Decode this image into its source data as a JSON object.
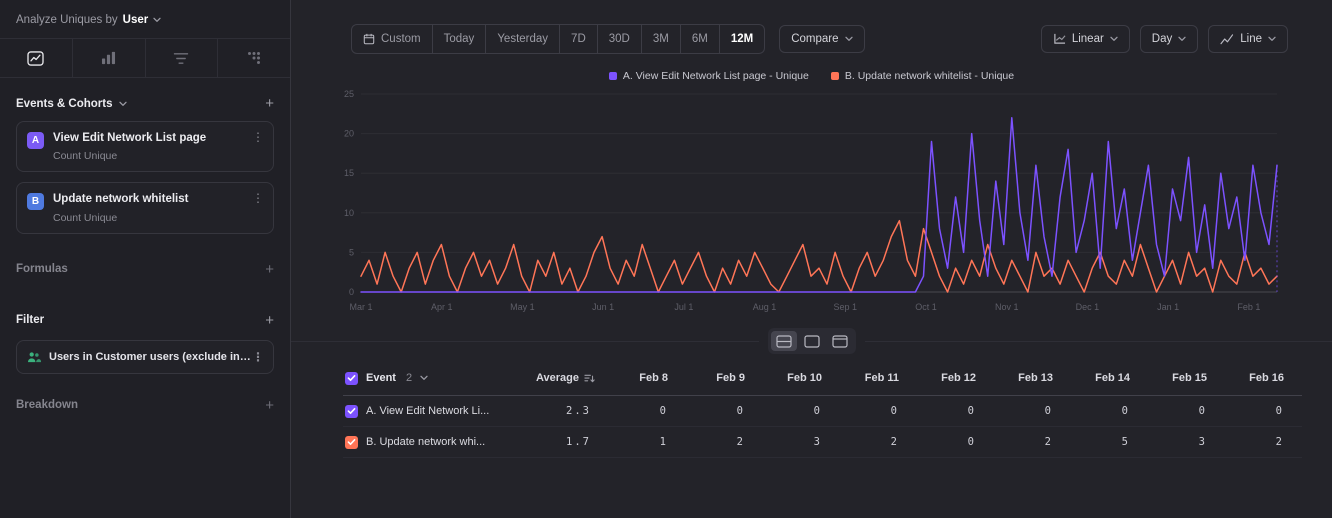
{
  "sidebar": {
    "analyze": {
      "label": "Analyze Uniques by",
      "value": "User"
    },
    "tabs": [
      "insights",
      "funnels",
      "flows",
      "retention"
    ],
    "active_tab": "insights",
    "events_section": {
      "title": "Events & Cohorts",
      "add_label": "+"
    },
    "events": [
      {
        "badge": "A",
        "badge_color": "#7b5bf5",
        "name": "View Edit Network List page",
        "subtitle": "Count Unique"
      },
      {
        "badge": "B",
        "badge_color": "#4f7ae0",
        "name": "Update network whitelist",
        "subtitle": "Count Unique"
      }
    ],
    "formulas_section": {
      "title": "Formulas",
      "add_label": "+"
    },
    "filter_section": {
      "title": "Filter",
      "add_label": "+"
    },
    "filters": [
      {
        "label": "Users in Customer users (exclude intern...",
        "icon": "users",
        "icon_color": "#3bb27e"
      }
    ],
    "breakdown_section": {
      "title": "Breakdown",
      "add_label": "+"
    }
  },
  "toolbar": {
    "date_ranges": [
      "Custom",
      "Today",
      "Yesterday",
      "7D",
      "30D",
      "3M",
      "6M",
      "12M"
    ],
    "selected_range": "12M",
    "compare_label": "Compare",
    "scale_label": "Linear",
    "granularity_label": "Day",
    "chart_type_label": "Line"
  },
  "legend": [
    {
      "label": "A. View Edit Network List page - Unique",
      "color": "#7c52ff"
    },
    {
      "label": "B. Update network whitelist - Unique",
      "color": "#ff7557"
    }
  ],
  "chart_data": {
    "type": "line",
    "title": "",
    "xlabel": "",
    "ylabel": "",
    "ylim": [
      0,
      25
    ],
    "yticks": [
      0,
      5,
      10,
      15,
      20,
      25
    ],
    "x_tick_labels": [
      "Mar 1",
      "Apr 1",
      "May 1",
      "Jun 1",
      "Jul 1",
      "Aug 1",
      "Sep 1",
      "Oct 1",
      "Nov 1",
      "Dec 1",
      "Jan 1",
      "Feb 1"
    ],
    "x_unit": "day",
    "grid": "horizontal",
    "legend_position": "top-center",
    "series": [
      {
        "name": "A. View Edit Network List page - Unique",
        "color": "#7c52ff",
        "values": [
          0,
          0,
          0,
          0,
          0,
          0,
          0,
          0,
          0,
          0,
          0,
          0,
          0,
          0,
          0,
          0,
          0,
          0,
          0,
          0,
          0,
          0,
          0,
          0,
          0,
          0,
          0,
          0,
          0,
          0,
          0,
          0,
          0,
          0,
          0,
          0,
          0,
          0,
          0,
          0,
          0,
          0,
          0,
          0,
          0,
          0,
          0,
          0,
          0,
          0,
          0,
          0,
          0,
          0,
          0,
          0,
          0,
          0,
          0,
          0,
          0,
          0,
          0,
          0,
          0,
          0,
          0,
          0,
          0,
          0,
          2,
          19,
          8,
          3,
          12,
          5,
          20,
          9,
          2,
          14,
          6,
          22,
          10,
          4,
          16,
          7,
          2,
          12,
          18,
          5,
          9,
          15,
          3,
          19,
          8,
          13,
          4,
          10,
          16,
          6,
          2,
          13,
          9,
          17,
          5,
          11,
          3,
          15,
          8,
          12,
          4,
          16,
          10,
          6,
          16
        ]
      },
      {
        "name": "B. Update network whitelist - Unique",
        "color": "#ff7557",
        "values": [
          2,
          4,
          1,
          5,
          2,
          0,
          3,
          5,
          1,
          4,
          6,
          2,
          0,
          3,
          5,
          2,
          4,
          1,
          3,
          6,
          2,
          0,
          4,
          2,
          5,
          1,
          3,
          0,
          2,
          5,
          7,
          3,
          1,
          4,
          2,
          6,
          3,
          0,
          2,
          4,
          1,
          3,
          5,
          2,
          0,
          3,
          1,
          4,
          2,
          5,
          3,
          1,
          0,
          2,
          4,
          6,
          2,
          3,
          1,
          5,
          2,
          0,
          3,
          5,
          2,
          4,
          7,
          9,
          4,
          2,
          8,
          5,
          2,
          0,
          3,
          1,
          4,
          2,
          6,
          3,
          1,
          4,
          2,
          0,
          5,
          2,
          3,
          1,
          4,
          2,
          0,
          3,
          5,
          2,
          1,
          4,
          2,
          6,
          3,
          0,
          2,
          4,
          1,
          5,
          2,
          3,
          0,
          4,
          2,
          1,
          5,
          2,
          3,
          1,
          2
        ]
      }
    ]
  },
  "table": {
    "event_header": "Event",
    "event_count": "2",
    "average_header": "Average",
    "date_columns": [
      "Feb 8",
      "Feb 9",
      "Feb 10",
      "Feb 11",
      "Feb 12",
      "Feb 13",
      "Feb 14",
      "Feb 15",
      "Feb 16"
    ],
    "header_checkbox_color": "#7c52ff",
    "rows": [
      {
        "label": "A. View Edit Network Li...",
        "color": "#7c52ff",
        "average": "2.3",
        "values": [
          "0",
          "0",
          "0",
          "0",
          "0",
          "0",
          "0",
          "0",
          "0"
        ]
      },
      {
        "label": "B. Update network whi...",
        "color": "#ff7557",
        "average": "1.7",
        "values": [
          "1",
          "2",
          "3",
          "2",
          "0",
          "2",
          "5",
          "3",
          "2"
        ]
      }
    ]
  }
}
